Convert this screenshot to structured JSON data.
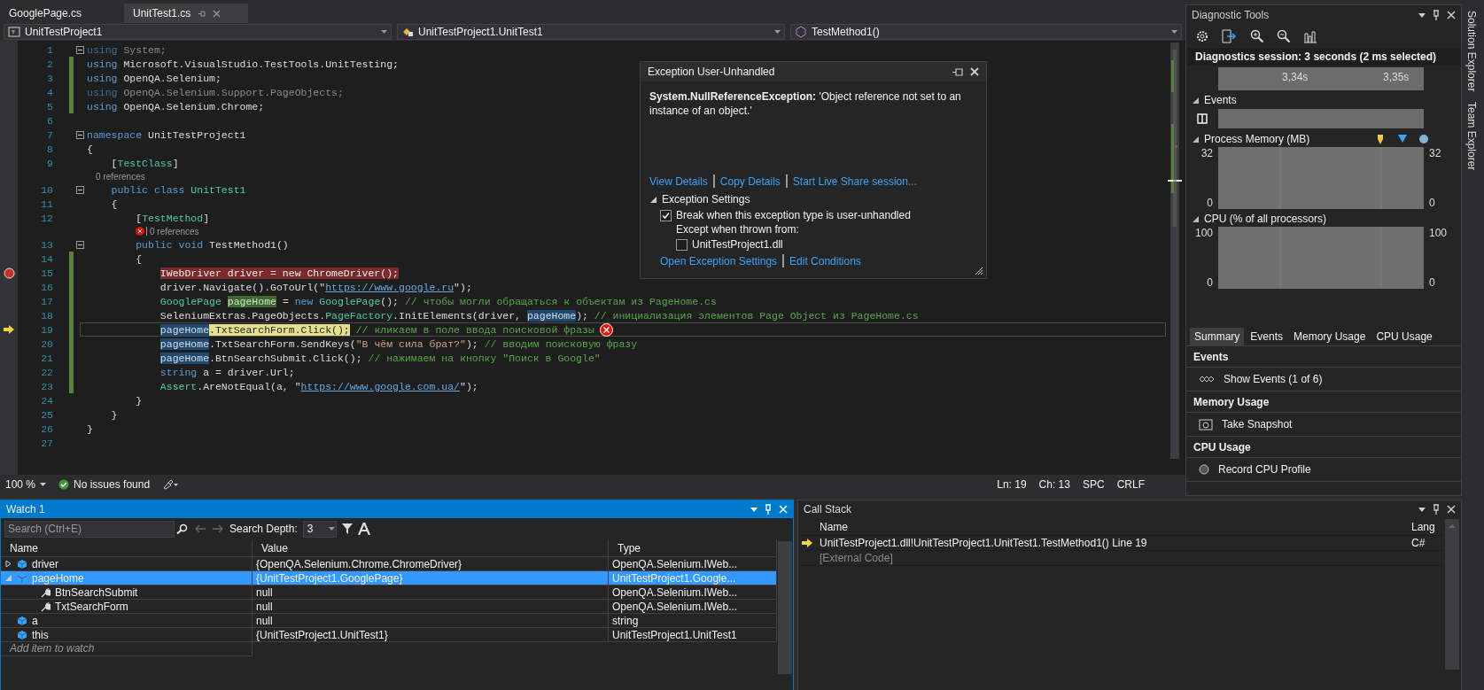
{
  "editor": {
    "tabs": [
      {
        "label": "GooglePage.cs",
        "selected": false
      },
      {
        "label": "UnitTest1.cs",
        "selected": true
      }
    ],
    "nav": [
      {
        "label": "UnitTestProject1",
        "kind": "project"
      },
      {
        "label": "UnitTestProject1.UnitTest1",
        "kind": "class"
      },
      {
        "label": "TestMethod1()",
        "kind": "method"
      }
    ],
    "lines": [
      {
        "kind": "code",
        "n": "1",
        "expanded": true,
        "changed": false,
        "breakpoint": false,
        "current": false,
        "segments": [
          {
            "t": "using",
            "kind": "kwdim"
          },
          {
            "t": " System;",
            "kind": "dim"
          }
        ]
      },
      {
        "kind": "code",
        "n": "2",
        "changed": true,
        "breakpoint": false,
        "current": false,
        "segments": [
          {
            "t": "using",
            "kind": "kw"
          },
          {
            "t": " Microsoft.VisualStudio.TestTools.UnitTesting;",
            "kind": "plain"
          }
        ]
      },
      {
        "kind": "code",
        "n": "3",
        "changed": true,
        "breakpoint": false,
        "current": false,
        "segments": [
          {
            "t": "using",
            "kind": "kw"
          },
          {
            "t": " OpenQA.Selenium;",
            "kind": "plain"
          }
        ]
      },
      {
        "kind": "code",
        "n": "4",
        "changed": true,
        "breakpoint": false,
        "current": false,
        "segments": [
          {
            "t": "using",
            "kind": "kwdim"
          },
          {
            "t": " OpenQA.Selenium.Support.PageObjects;",
            "kind": "dim"
          }
        ]
      },
      {
        "kind": "code",
        "n": "5",
        "changed": true,
        "breakpoint": false,
        "current": false,
        "segments": [
          {
            "t": "using",
            "kind": "kw"
          },
          {
            "t": " OpenQA.Selenium.Chrome;",
            "kind": "plain"
          }
        ]
      },
      {
        "kind": "code",
        "n": "6",
        "changed": false,
        "breakpoint": false,
        "current": false
      },
      {
        "kind": "code",
        "n": "7",
        "expanded": true,
        "changed": false,
        "breakpoint": false,
        "current": false,
        "segments": [
          {
            "t": "namespace",
            "kind": "kw"
          },
          {
            "t": " UnitTestProject1",
            "kind": "plain"
          }
        ]
      },
      {
        "kind": "code",
        "n": "8",
        "changed": false,
        "breakpoint": false,
        "current": false,
        "segments": [
          {
            "t": "{",
            "kind": "plain"
          }
        ]
      },
      {
        "kind": "code",
        "n": "9",
        "changed": false,
        "breakpoint": false,
        "current": false,
        "segments": [
          {
            "t": "    [",
            "kind": "plain"
          },
          {
            "t": "TestClass",
            "kind": "type"
          },
          {
            "t": "]",
            "kind": "plain"
          }
        ]
      },
      {
        "kind": "lens",
        "text": "    0 references",
        "error": false
      },
      {
        "kind": "code",
        "n": "10",
        "expanded": true,
        "changed": false,
        "breakpoint": false,
        "current": false,
        "segments": [
          {
            "t": "    public class ",
            "kind": "kw"
          },
          {
            "t": "UnitTest1",
            "kind": "type"
          }
        ]
      },
      {
        "kind": "code",
        "n": "11",
        "changed": false,
        "breakpoint": false,
        "current": false,
        "segments": [
          {
            "t": "    {",
            "kind": "plain"
          }
        ]
      },
      {
        "kind": "code",
        "n": "12",
        "changed": false,
        "breakpoint": false,
        "current": false,
        "segments": [
          {
            "t": "        [",
            "kind": "plain"
          },
          {
            "t": "TestMethod",
            "kind": "type"
          },
          {
            "t": "]",
            "kind": "plain"
          }
        ]
      },
      {
        "kind": "lens",
        "text": "0 references",
        "error": true
      },
      {
        "kind": "code",
        "n": "13",
        "expanded": true,
        "changed": false,
        "breakpoint": false,
        "current": false,
        "segments": [
          {
            "t": "        public void",
            "kind": "kw"
          },
          {
            "t": " TestMethod1()",
            "kind": "plain"
          }
        ]
      },
      {
        "kind": "code",
        "n": "14",
        "changed": true,
        "breakpoint": false,
        "current": false,
        "segments": [
          {
            "t": "        {",
            "kind": "plain"
          }
        ]
      },
      {
        "kind": "code",
        "n": "15",
        "changed": true,
        "breakpoint": true,
        "current": false,
        "segments": [
          {
            "t": "            IWebDriver driver = new ChromeDriver();",
            "kind": "breakpoint"
          }
        ]
      },
      {
        "kind": "code",
        "n": "16",
        "changed": true,
        "breakpoint": false,
        "current": false,
        "segments": [
          {
            "t": "            driver.Navigate().GoToUrl(\"",
            "kind": "plain"
          },
          {
            "t": "https://www.google.ru",
            "kind": "link"
          },
          {
            "t": "\");",
            "kind": "plain"
          }
        ]
      },
      {
        "kind": "code",
        "n": "17",
        "changed": true,
        "breakpoint": false,
        "current": false,
        "segments": [
          {
            "t": "            GooglePage ",
            "kind": "type"
          },
          {
            "t": "pageHome",
            "kind": "definition"
          },
          {
            "t": " = ",
            "kind": "plain"
          },
          {
            "t": "new ",
            "kind": "kw"
          },
          {
            "t": "GooglePage",
            "kind": "type"
          },
          {
            "t": "(); ",
            "kind": "plain"
          },
          {
            "t": "// чтобы могли обращаться к объектам из PageHome.cs",
            "kind": "comment"
          }
        ]
      },
      {
        "kind": "code",
        "n": "18",
        "changed": true,
        "breakpoint": false,
        "current": false,
        "segments": [
          {
            "t": "            SeleniumExtras.PageObjects.",
            "kind": "plain"
          },
          {
            "t": "PageFactory",
            "kind": "type"
          },
          {
            "t": ".InitElements(driver, ",
            "kind": "plain"
          },
          {
            "t": "pageHome",
            "kind": "reference"
          },
          {
            "t": "); ",
            "kind": "plain"
          },
          {
            "t": "// инициализация элементов Page Object из PageHome.cs",
            "kind": "comment"
          }
        ]
      },
      {
        "kind": "code",
        "n": "19",
        "changed": true,
        "breakpoint": false,
        "current": true,
        "exception": true,
        "segments": [
          {
            "t": "            pageHome",
            "kind": "reference"
          },
          {
            "t": ".TxtSearchForm.Click();",
            "kind": "current"
          },
          {
            "t": " // кликаем в поле ввода поисковой фразы",
            "kind": "comment"
          }
        ]
      },
      {
        "kind": "code",
        "n": "20",
        "changed": true,
        "breakpoint": false,
        "current": false,
        "segments": [
          {
            "t": "            pageHome",
            "kind": "reference"
          },
          {
            "t": ".TxtSearchForm.SendKeys(",
            "kind": "plain"
          },
          {
            "t": "\"В чём сила брат?\"",
            "kind": "str"
          },
          {
            "t": "); ",
            "kind": "plain"
          },
          {
            "t": "// вводим поисковую фразу",
            "kind": "comment"
          }
        ]
      },
      {
        "kind": "code",
        "n": "21",
        "changed": true,
        "breakpoint": false,
        "current": false,
        "segments": [
          {
            "t": "            pageHome",
            "kind": "reference"
          },
          {
            "t": ".BtnSearchSubmit.Click(); ",
            "kind": "plain"
          },
          {
            "t": "// нажимаем на кнопку \"Поиск в Google\"",
            "kind": "comment"
          }
        ]
      },
      {
        "kind": "code",
        "n": "22",
        "changed": true,
        "breakpoint": false,
        "current": false,
        "segments": [
          {
            "t": "            string",
            "kind": "kw"
          },
          {
            "t": " a = driver.Url;",
            "kind": "plain"
          }
        ]
      },
      {
        "kind": "code",
        "n": "23",
        "changed": true,
        "breakpoint": false,
        "current": false,
        "segments": [
          {
            "t": "            Assert",
            "kind": "type"
          },
          {
            "t": ".AreNotEqual(a, \"",
            "kind": "plain"
          },
          {
            "t": "https://www.google.com.ua/",
            "kind": "link"
          },
          {
            "t": "\");",
            "kind": "plain"
          }
        ]
      },
      {
        "kind": "code",
        "n": "24",
        "changed": false,
        "breakpoint": false,
        "current": false,
        "segments": [
          {
            "t": "        }",
            "kind": "plain"
          }
        ]
      },
      {
        "kind": "code",
        "n": "25",
        "changed": false,
        "breakpoint": false,
        "current": false,
        "segments": [
          {
            "t": "    }",
            "kind": "plain"
          }
        ]
      },
      {
        "kind": "code",
        "n": "26",
        "changed": false,
        "breakpoint": false,
        "current": false,
        "segments": [
          {
            "t": "}",
            "kind": "plain"
          }
        ]
      },
      {
        "kind": "code",
        "n": "27",
        "changed": false,
        "breakpoint": false,
        "current": false
      }
    ],
    "status": {
      "zoom": "100 %",
      "issues": "No issues found",
      "ln": "Ln: 19",
      "ch": "Ch: 13",
      "indent": "SPC",
      "eol": "CRLF"
    }
  },
  "exception": {
    "title": "Exception User-Unhandled",
    "message": "**System.NullReferenceException:** 'Object reference not set to an instance of an object.'",
    "links": [
      "View Details",
      "Copy Details",
      "Start Live Share session..."
    ],
    "settings": {
      "label": "Exception Settings",
      "expanded": true,
      "break": {
        "label": "Break when this exception type is user-unhandled",
        "checked": true
      },
      "except_label": "Except when thrown from:",
      "module": {
        "label": "UnitTestProject1.dll",
        "checked": false
      }
    },
    "bottom_links": [
      "Open Exception Settings",
      "Edit Conditions"
    ]
  },
  "diagnostics": {
    "title": "Diagnostic Tools",
    "session": "Diagnostics session: 3 seconds (2 ms selected)",
    "ticks": [
      "3,34s",
      "3,35s"
    ],
    "sections": [
      {
        "kind": "events",
        "label": "Events",
        "expanded": true
      },
      {
        "kind": "graph",
        "label": "Process Memory (MB)",
        "expanded": true,
        "markers": true,
        "left_ticks": [
          "32",
          "0"
        ],
        "right_ticks": [
          "32",
          "0"
        ]
      },
      {
        "kind": "graph",
        "label": "CPU (% of all processors)",
        "expanded": true,
        "markers": false,
        "left_ticks": [
          "100",
          "0"
        ],
        "right_ticks": [
          "100",
          "0"
        ]
      }
    ],
    "tabs": [
      {
        "label": "Summary",
        "selected": true
      },
      {
        "label": "Events",
        "selected": false
      },
      {
        "label": "Memory Usage",
        "selected": false
      },
      {
        "label": "CPU Usage",
        "selected": false
      }
    ],
    "summary": [
      {
        "heading": "Events",
        "action": "Show Events (1 of 6)",
        "kind": "events"
      },
      {
        "heading": "Memory Usage",
        "action": "Take Snapshot",
        "kind": "camera"
      },
      {
        "heading": "CPU Usage",
        "action": "Record CPU Profile",
        "kind": "record"
      }
    ]
  },
  "side_tabs": [
    "Solution Explorer",
    "Team Explorer"
  ],
  "watch": {
    "title": "Watch 1",
    "search": {
      "placeholder": "Search (Ctrl+E)"
    },
    "depth_label": "Search Depth:",
    "depth": "3",
    "columns": [
      "Name",
      "Value",
      "Type"
    ],
    "rows": [
      {
        "name": "driver",
        "value": "{OpenQA.Selenium.Chrome.ChromeDriver}",
        "type": "OpenQA.Selenium.IWeb...",
        "kind": "local",
        "expanded": false,
        "selected": false
      },
      {
        "name": "pageHome",
        "value": "{UnitTestProject1.GooglePage}",
        "type": "UnitTestProject1.Google...",
        "kind": "local",
        "expanded": true,
        "selected": true,
        "children": [
          {
            "name": "BtnSearchSubmit",
            "value": "null",
            "type": "OpenQA.Selenium.IWeb...",
            "kind": "property",
            "selected": false
          },
          {
            "name": "TxtSearchForm",
            "value": "null",
            "type": "OpenQA.Selenium.IWeb...",
            "kind": "property",
            "selected": false
          }
        ]
      },
      {
        "name": "a",
        "value": "null",
        "type": "string",
        "kind": "local",
        "selected": false
      },
      {
        "name": "this",
        "value": "{UnitTestProject1.UnitTest1}",
        "type": "UnitTestProject1.UnitTest1",
        "kind": "local",
        "selected": false
      }
    ],
    "add_placeholder": "Add item to watch"
  },
  "call_stack": {
    "title": "Call Stack",
    "columns": [
      "Name",
      "Lang"
    ],
    "rows": [
      {
        "name": "UnitTestProject1.dll!UnitTestProject1.UnitTest1.TestMethod1() Line 19",
        "lang": "C#",
        "current": true,
        "external": false
      },
      {
        "name": "[External Code]",
        "current": false,
        "external": true
      }
    ]
  }
}
